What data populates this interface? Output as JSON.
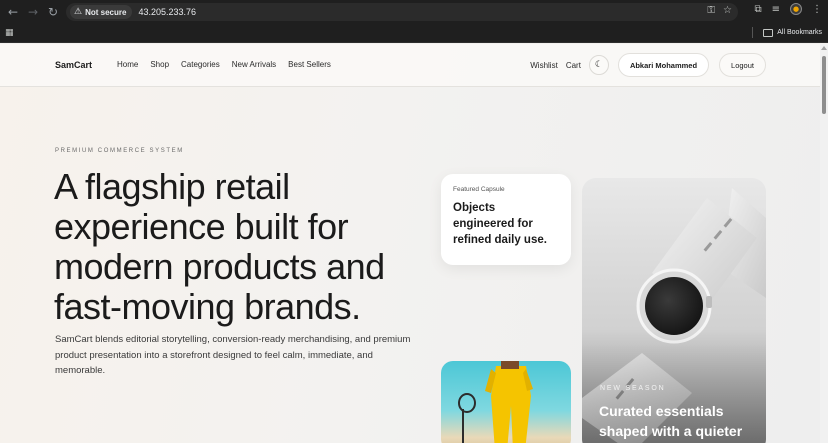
{
  "browser": {
    "security_label": "Not secure",
    "url": "43.205.233.76",
    "bookmarks_label": "All Bookmarks"
  },
  "header": {
    "logo": "SamCart",
    "nav": [
      "Home",
      "Shop",
      "Categories",
      "New Arrivals",
      "Best Sellers"
    ],
    "wishlist": "Wishlist",
    "cart": "Cart",
    "user_name": "Abkari Mohammed",
    "logout": "Logout"
  },
  "hero": {
    "eyebrow": "PREMIUM COMMERCE SYSTEM",
    "headline": "A flagship retail experience built for modern products and fast-moving brands.",
    "lede": "SamCart blends editorial storytelling, conversion-ready merchandising, and premium product presentation into a storefront designed to feel calm, immediate, and memorable."
  },
  "capsule": {
    "label": "Featured Capsule",
    "title": "Objects engineered for refined daily use."
  },
  "feature": {
    "season": "NEW SEASON",
    "title": "Curated essentials shaped with a quieter"
  },
  "icons": {
    "back": "arrow-left-icon",
    "forward": "arrow-right-icon",
    "reload": "reload-icon",
    "warning": "warning-icon",
    "theme": "moon-icon"
  }
}
